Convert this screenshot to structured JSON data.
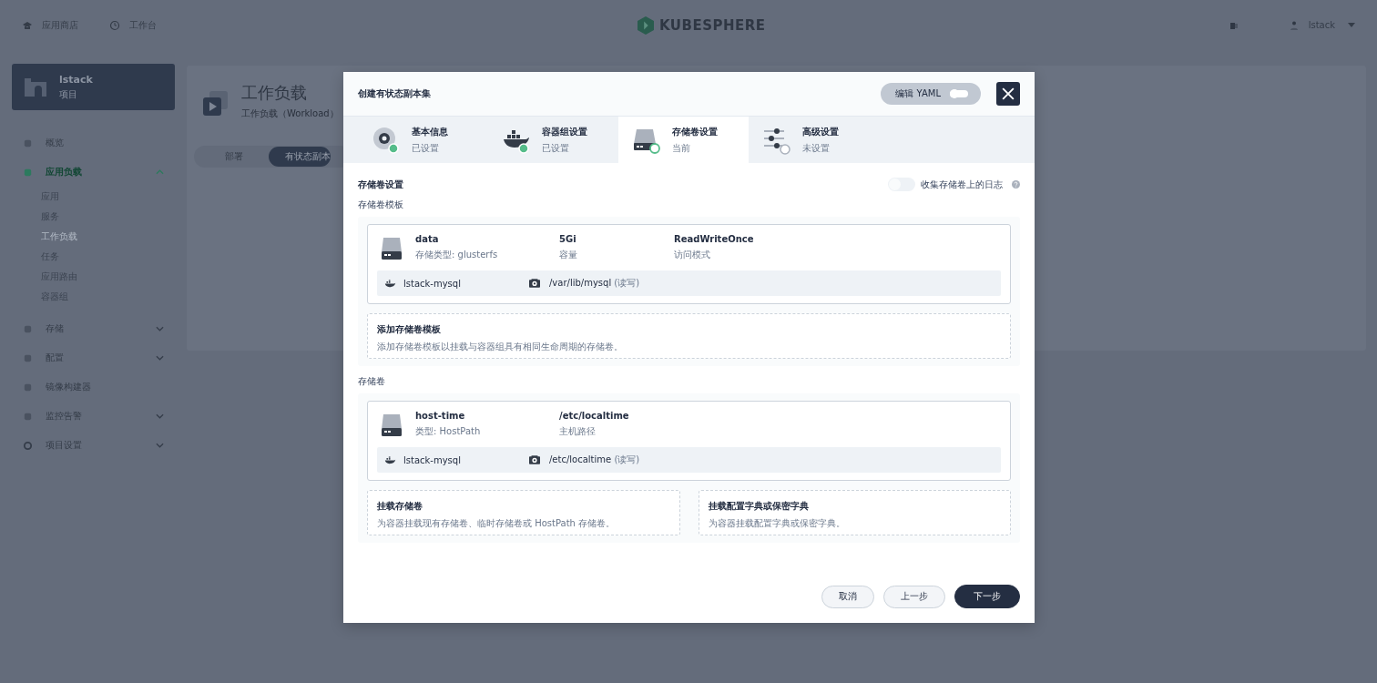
{
  "top_nav": {
    "items": [
      {
        "label": "应用商店",
        "kind": "store"
      },
      {
        "label": "工作台",
        "kind": "desk"
      }
    ],
    "logo": "KUBESPHERE",
    "user": "lstack"
  },
  "project": {
    "name": "lstack",
    "type": "项目"
  },
  "sidebar": {
    "items": [
      {
        "label": "概览",
        "kind": "overview",
        "selected": false
      },
      {
        "label": "应用负载",
        "kind": "apps",
        "selected": true,
        "expanded": true,
        "children": [
          {
            "label": "应用",
            "selected": false
          },
          {
            "label": "服务",
            "selected": false
          },
          {
            "label": "工作负载",
            "selected": true
          },
          {
            "label": "任务",
            "selected": false
          },
          {
            "label": "应用路由",
            "selected": false
          },
          {
            "label": "容器组",
            "selected": false
          }
        ]
      },
      {
        "label": "存储",
        "kind": "storage",
        "selected": false,
        "expanded": false
      },
      {
        "label": "配置",
        "kind": "config",
        "selected": false,
        "expanded": false
      },
      {
        "label": "镜像构建器",
        "kind": "builder",
        "selected": false
      },
      {
        "label": "监控告警",
        "kind": "monitor",
        "selected": false,
        "expanded": false
      },
      {
        "label": "项目设置",
        "kind": "settings",
        "selected": false,
        "expanded": false
      }
    ]
  },
  "page_header": {
    "title": "工作负载",
    "subtitle": "工作负载（Workload）",
    "tabs": [
      {
        "label": "部署",
        "selected": false
      },
      {
        "label": "有状态副本",
        "selected": true
      }
    ]
  },
  "modal": {
    "title": "创建有状态副本集",
    "yaml_toggle": {
      "label": "编辑 YAML",
      "on": false
    },
    "steps": [
      {
        "kind": "basic",
        "title": "基本信息",
        "status": "已设置",
        "completed": true,
        "selected": false
      },
      {
        "kind": "container",
        "title": "容器组设置",
        "status": "已设置",
        "completed": true,
        "selected": false
      },
      {
        "kind": "volume",
        "title": "存储卷设置",
        "status": "当前",
        "completed": false,
        "selected": true
      },
      {
        "kind": "advanced",
        "title": "高级设置",
        "status": "未设置",
        "completed": false,
        "selected": false
      }
    ],
    "section_title": "存储卷设置",
    "log_toggle": {
      "label": "收集存储卷上的日志",
      "on": false
    },
    "groups": [
      {
        "label": "存储卷模板",
        "cards": [
          {
            "fields": [
              {
                "value": "data",
                "label": "存储类型: glusterfs"
              },
              {
                "value": "5Gi",
                "label": "容量"
              },
              {
                "value": "ReadWriteOnce",
                "label": "访问模式"
              }
            ],
            "mounts": [
              {
                "container": "lstack-mysql",
                "path": "/var/lib/mysql",
                "mode": "(读写)"
              }
            ]
          }
        ],
        "adds": [
          {
            "title": "添加存储卷模板",
            "description": "添加存储卷模板以挂载与容器组具有相同生命周期的存储卷。"
          }
        ]
      },
      {
        "label": "存储卷",
        "cards": [
          {
            "fields": [
              {
                "value": "host-time",
                "label": "类型: HostPath"
              },
              {
                "value": "/etc/localtime",
                "label": "主机路径"
              }
            ],
            "mounts": [
              {
                "container": "lstack-mysql",
                "path": "/etc/localtime",
                "mode": "(读写)"
              }
            ]
          }
        ],
        "adds": [
          {
            "title": "挂载存储卷",
            "description": "为容器挂载现有存储卷、临时存储卷或 HostPath 存储卷。"
          },
          {
            "title": "挂载配置字典或保密字典",
            "description": "为容器挂载配置字典或保密字典。"
          }
        ]
      }
    ],
    "actions": [
      {
        "label": "取消",
        "kind": "secondary"
      },
      {
        "label": "上一步",
        "kind": "secondary"
      },
      {
        "label": "下一步",
        "kind": "primary"
      }
    ]
  }
}
